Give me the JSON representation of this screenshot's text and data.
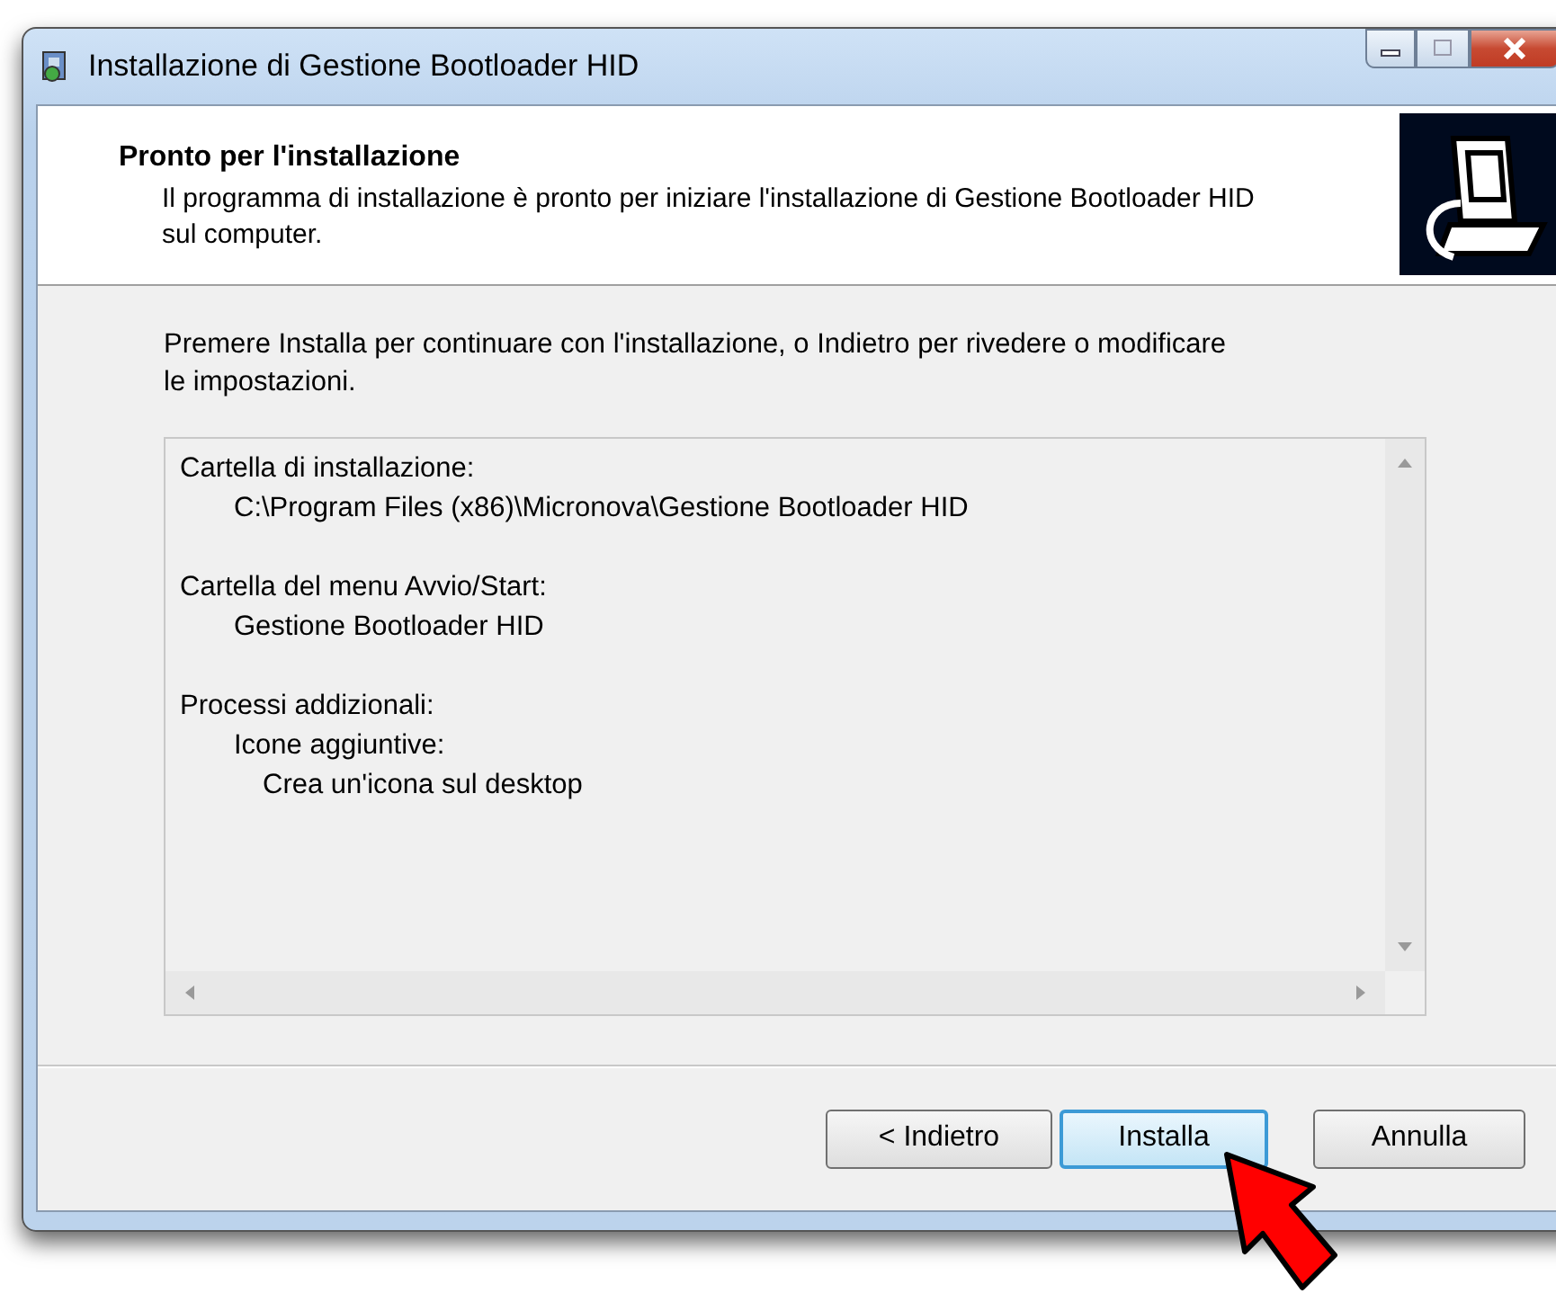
{
  "window": {
    "title": "Installazione di Gestione Bootloader HID"
  },
  "header": {
    "title": "Pronto per l'installazione",
    "subtitle": "Il programma di installazione è pronto per iniziare l'installazione di Gestione Bootloader HID sul computer."
  },
  "intro": "Premere Installa per continuare con l'installazione, o Indietro per rivedere o modificare le impostazioni.",
  "summary": [
    {
      "text": "Cartella di installazione:",
      "children": [
        {
          "text": "C:\\Program Files (x86)\\Micronova\\Gestione Bootloader HID"
        }
      ]
    },
    {
      "text": "Cartella del menu Avvio/Start:",
      "children": [
        {
          "text": "Gestione Bootloader HID"
        }
      ]
    },
    {
      "text": "Processi addizionali:",
      "children": [
        {
          "text": "Icone aggiuntive:",
          "children": [
            {
              "text": "Crea un'icona sul desktop"
            }
          ]
        }
      ]
    }
  ],
  "buttons": [
    {
      "label": "< Indietro",
      "focused": false
    },
    {
      "label": "Installa",
      "focused": true
    },
    {
      "label": "Annulla",
      "focused": false
    }
  ]
}
